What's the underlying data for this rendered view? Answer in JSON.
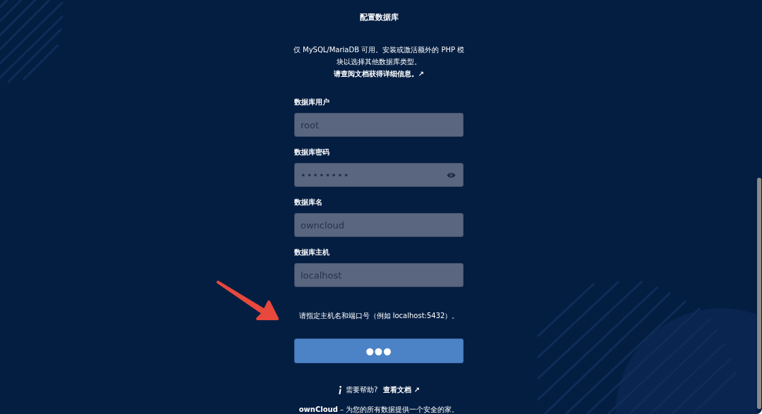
{
  "title": "配置数据库",
  "notice": {
    "text": "仅 MySQL/MariaDB 可用。安装或激活额外的 PHP 模块以选择其他数据库类型。",
    "link": "请查阅文档获得详细信息。↗"
  },
  "fields": [
    {
      "label": "数据库用户",
      "placeholder": "root",
      "kind": "text"
    },
    {
      "label": "数据库密码",
      "value": "••••••••",
      "kind": "password"
    },
    {
      "label": "数据库名",
      "placeholder": "owncloud",
      "kind": "text"
    },
    {
      "label": "数据库主机",
      "placeholder": "localhost",
      "kind": "text"
    }
  ],
  "host_hint": "请指定主机名和端口号（例如 localhost:5432）。",
  "submit_button": {
    "label": "●●●"
  },
  "help": {
    "text": "需要帮助?",
    "link": "查看文档 ↗"
  },
  "footer": "**ownCloud** – 为您的所有数据提供一个安全的家。"
}
